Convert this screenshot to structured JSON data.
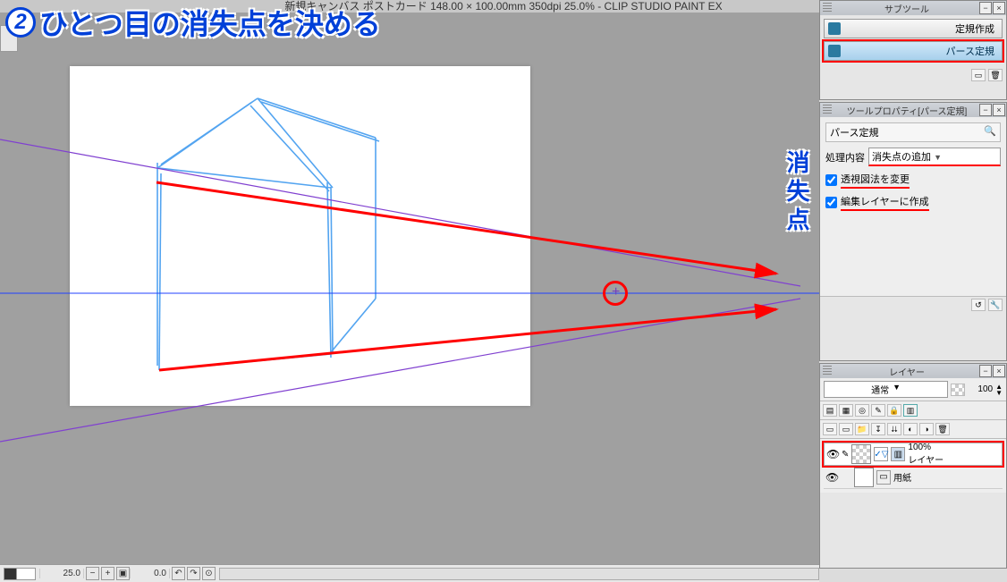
{
  "app": {
    "title": "新規キャンバス ポストカード 148.00 × 100.00mm 350dpi 25.0%  -  CLIP STUDIO PAINT EX"
  },
  "annotation": {
    "step_number": "2",
    "step_text": "ひとつ目の消失点を決める",
    "vp_label": "消失点"
  },
  "subtool": {
    "panel_title": "サブツール",
    "item1": "定規作成",
    "item2": "パース定規"
  },
  "toolprop": {
    "panel_title": "ツールプロパティ[パース定規]",
    "tool_name": "パース定規",
    "process_label": "処理内容",
    "process_value": "消失点の追加",
    "cb1_label": "透視図法を変更",
    "cb2_label": "編集レイヤーに作成"
  },
  "layer": {
    "panel_title": "レイヤー",
    "blend_mode": "通常",
    "opacity": "100",
    "layer1_name": "100%\nレイヤー",
    "layer2_name": "用紙"
  },
  "status": {
    "zoom": "25.0",
    "rotation": "0.0"
  }
}
